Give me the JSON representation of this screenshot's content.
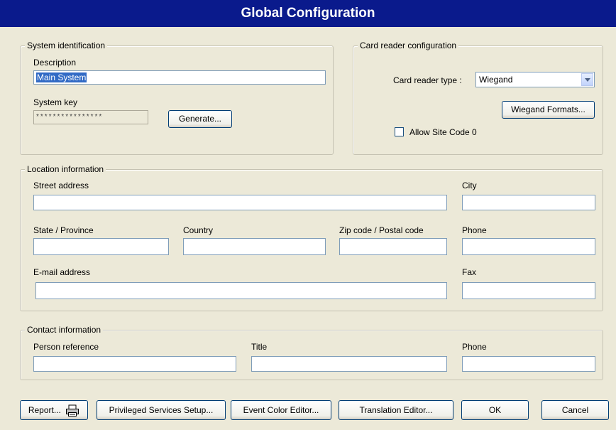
{
  "window": {
    "title": "Global Configuration"
  },
  "system_identification": {
    "legend": "System identification",
    "description_label": "Description",
    "description_value": "Main System",
    "system_key_label": "System key",
    "system_key_value": "****************",
    "generate_button": "Generate..."
  },
  "card_reader": {
    "legend": "Card reader configuration",
    "type_label": "Card reader type :",
    "type_value": "Wiegand",
    "formats_button": "Wiegand Formats...",
    "allow_site_code_label": "Allow Site Code 0",
    "allow_site_code_checked": false
  },
  "location": {
    "legend": "Location information",
    "street_label": "Street address",
    "city_label": "City",
    "state_label": "State / Province",
    "country_label": "Country",
    "zip_label": "Zip code / Postal code",
    "phone_label": "Phone",
    "email_label": "E-mail address",
    "fax_label": "Fax",
    "street_value": "",
    "city_value": "",
    "state_value": "",
    "country_value": "",
    "zip_value": "",
    "phone_value": "",
    "email_value": "",
    "fax_value": ""
  },
  "contact": {
    "legend": "Contact information",
    "person_label": "Person reference",
    "title_label": "Title",
    "phone_label": "Phone",
    "person_value": "",
    "title_value": "",
    "phone_value": ""
  },
  "buttons": {
    "report": "Report...",
    "privileged": "Privileged Services Setup...",
    "event_color": "Event Color Editor...",
    "translation": "Translation Editor...",
    "ok": "OK",
    "cancel": "Cancel"
  }
}
